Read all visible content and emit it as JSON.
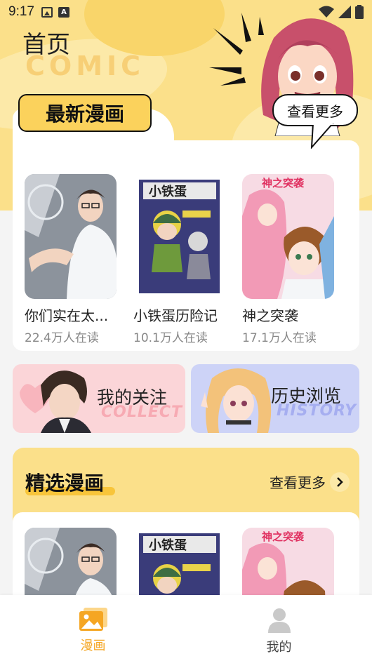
{
  "status_bar": {
    "time": "9:17"
  },
  "header": {
    "title": "首页",
    "decor_word": "COMIC"
  },
  "latest": {
    "label": "最新漫画",
    "see_more": "查看更多",
    "items": [
      {
        "title": "你们实在太...",
        "readers": "22.4万人在读",
        "cover_icon": "man-in-white-shirt-cover"
      },
      {
        "title": "小铁蛋历险记",
        "readers": "10.1万人在读",
        "cover_icon": "boy-adventure-cover"
      },
      {
        "title": "神之突袭",
        "readers": "17.1万人在读",
        "cover_icon": "anime-heroes-cover",
        "cover_caption": "神之突袭"
      }
    ]
  },
  "shortcuts": {
    "follow": {
      "label": "我的关注",
      "ghost": "COLLECT"
    },
    "history": {
      "label": "历史浏览",
      "ghost": "HISTORY"
    }
  },
  "featured": {
    "title": "精选漫画",
    "see_more": "查看更多",
    "cover_caption": "神之突袭"
  },
  "bottom_nav": {
    "items": [
      {
        "label": "漫画",
        "icon": "image-gallery-icon",
        "active": true
      },
      {
        "label": "我的",
        "icon": "user-icon",
        "active": false
      }
    ]
  },
  "colors": {
    "accent": "#f5a623",
    "hero_yellow": "#fbe08a",
    "label_yellow": "#fbd25c",
    "follow_bg": "#fbd5d8",
    "history_bg": "#cdd3f7"
  }
}
